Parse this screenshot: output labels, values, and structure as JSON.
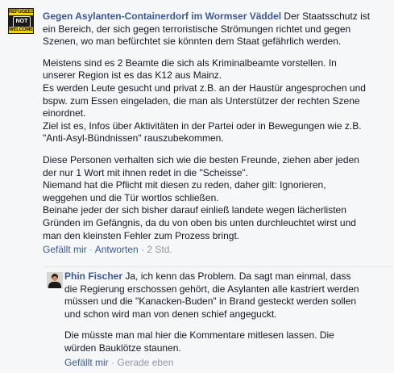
{
  "comment": {
    "author": "Gegen Asylanten-Containerdorf im Wormser Väddel",
    "avatar_text": {
      "top": "REFUGEES",
      "middle": "NOT",
      "bottom": "WELCOME"
    },
    "first_line_rest": " Der Staatsschutz ist",
    "intro_lines": [
      "ein Bereich, der sich gegen terroristische Strömungen richtet und gegen",
      "Szenen, wo man befürchtet sie könnten dem Staat gefährlich werden."
    ],
    "para2": [
      "Meistens sind es 2 Beamte die sich als Kriminalbeamte vorstellen. In",
      "unserer Region ist es das K12 aus Mainz.",
      "Es werden Leute gesucht und privat z.B. an der Haustür angesprochen und",
      "bspw. zum Essen eingeladen, die man als Unterstützer der rechten Szene",
      "einordnet.",
      "Ziel ist es, Infos über Aktivitäten in der Partei oder in Bewegungen wie z.B.",
      "\"Anti-Asyl-Bündnissen\" rauszubekommen."
    ],
    "para3": [
      "Diese Personen verhalten sich wie die besten Freunde, ziehen aber jeden",
      "der nur 1 Wort mit ihnen redet in die \"Scheisse\".",
      "Niemand hat die Pflicht mit diesen zu reden, daher gilt: Ignorieren,",
      "weggehen und die Tür wortlos schließen.",
      "Beinahe jeder der sich bisher darauf einließ landete wegen lächerlisten",
      "Gründen im Gefängnis, da du von oben bis unten durchleuchtet wirst und",
      "man den kleinsten Fehler zum Prozess bringt."
    ],
    "actions": {
      "like": "Gefällt mir",
      "sep1": " · ",
      "reply": "Antworten",
      "sep2": " · ",
      "time": "2 Std."
    }
  },
  "reply": {
    "author": "Phin Fischer",
    "first_line_rest": " Ja, ich kenn das Problem. Da sagt man einmal, dass",
    "lines": [
      "die Regierung erschossen gehört, die Asylanten alle kastriert werden",
      "müssen und die \"Kanacken-Buden\" in Brand gesteckt werden sollen",
      "und schon wird man von denen schief angeguckt."
    ],
    "para2": [
      "Die müsste man mal hier die Kommentare mitlesen lassen. Die",
      "würden Bauklötze staunen."
    ],
    "actions": {
      "like": "Gefällt mir",
      "sep": " · ",
      "time": "Gerade eben"
    }
  }
}
